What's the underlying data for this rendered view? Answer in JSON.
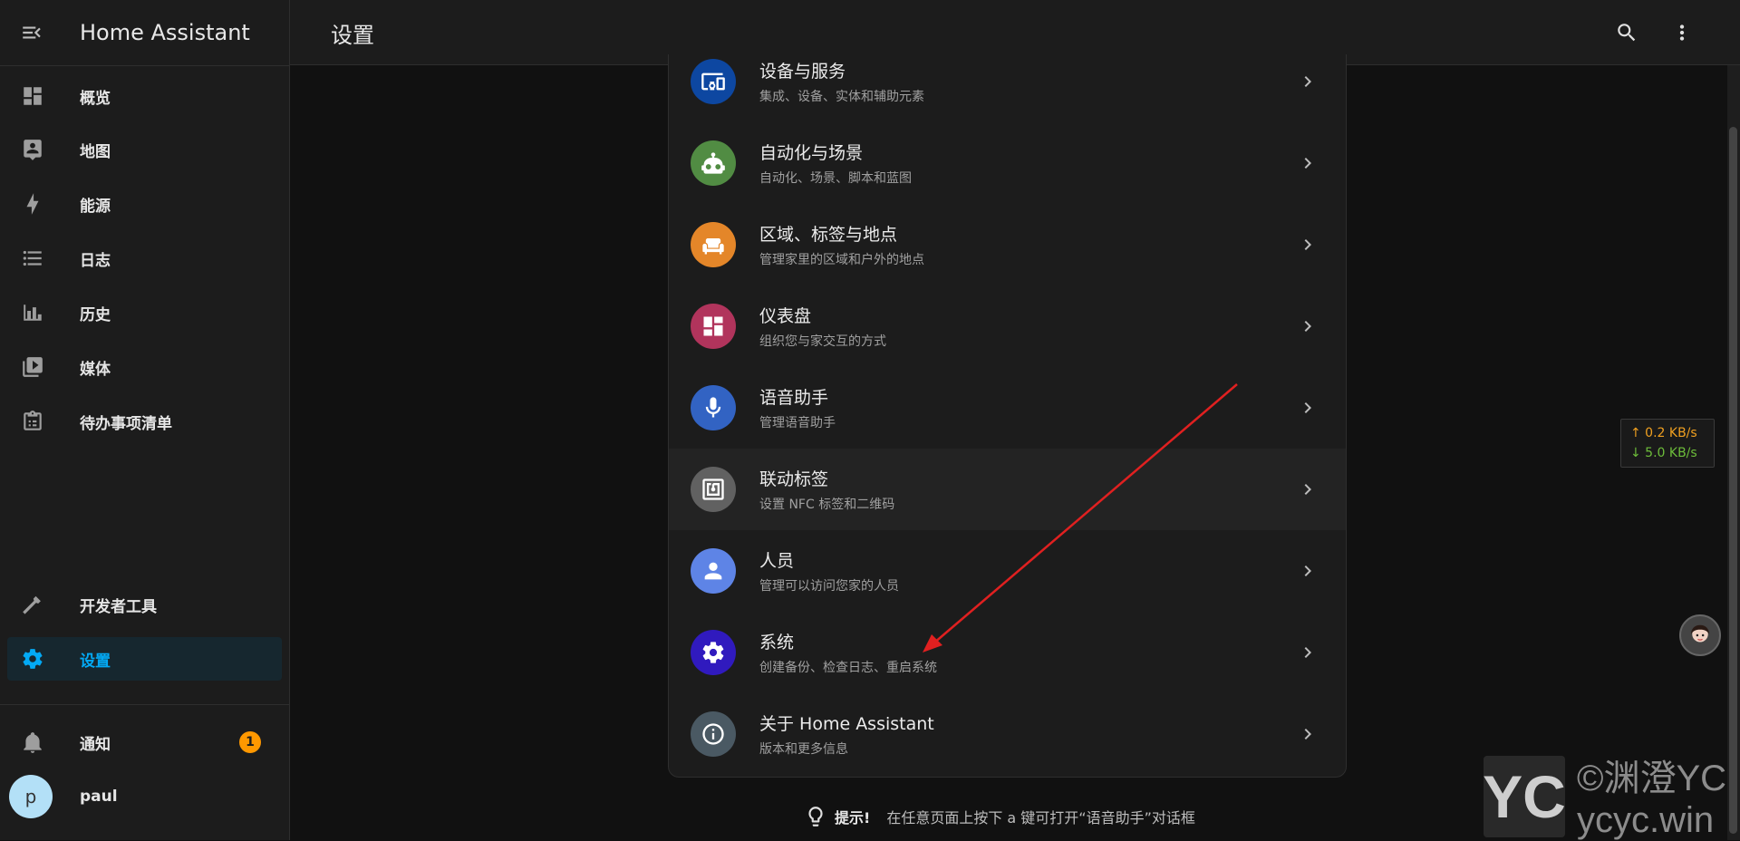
{
  "app": {
    "title": "Home Assistant"
  },
  "sidebar": {
    "items": [
      {
        "label": "概览",
        "icon": "dashboard-icon"
      },
      {
        "label": "地图",
        "icon": "map-icon"
      },
      {
        "label": "能源",
        "icon": "energy-icon"
      },
      {
        "label": "日志",
        "icon": "logbook-icon"
      },
      {
        "label": "历史",
        "icon": "history-icon"
      },
      {
        "label": "媒体",
        "icon": "media-icon"
      },
      {
        "label": "待办事项清单",
        "icon": "todo-icon"
      }
    ],
    "dev_tools": "开发者工具",
    "settings": "设置",
    "notifications": {
      "label": "通知",
      "count": "1"
    },
    "user": {
      "initial": "p",
      "name": "paul"
    }
  },
  "header": {
    "title": "设置"
  },
  "settings_list": [
    {
      "title": "设备与服务",
      "subtitle": "集成、设备、实体和辅助元素",
      "color": "#0d47a1",
      "icon": "devices-icon"
    },
    {
      "title": "自动化与场景",
      "subtitle": "自动化、场景、脚本和蓝图",
      "color": "#518c43",
      "icon": "robot-icon"
    },
    {
      "title": "区域、标签与地点",
      "subtitle": "管理家里的区域和户外的地点",
      "color": "#e48629",
      "icon": "sofa-icon"
    },
    {
      "title": "仪表盘",
      "subtitle": "组织您与家交互的方式",
      "color": "#b1345c",
      "icon": "dashboard-grid-icon"
    },
    {
      "title": "语音助手",
      "subtitle": "管理语音助手",
      "color": "#3263c3",
      "icon": "microphone-icon"
    },
    {
      "title": "联动标签",
      "subtitle": "设置 NFC 标签和二维码",
      "color": "#616161",
      "icon": "nfc-icon"
    },
    {
      "title": "人员",
      "subtitle": "管理可以访问您家的人员",
      "color": "#5e84e6",
      "icon": "account-icon"
    },
    {
      "title": "系统",
      "subtitle": "创建备份、检查日志、重启系统",
      "color": "#301abe",
      "icon": "cog-icon"
    },
    {
      "title": "关于 Home Assistant",
      "subtitle": "版本和更多信息",
      "color": "#4a5963",
      "icon": "info-icon"
    }
  ],
  "tip": {
    "label": "提示!",
    "text": "在任意页面上按下 a 键可打开“语音助手”对话框"
  },
  "net_speed": {
    "up": "↑ 0.2 KB/s",
    "down": "↓ 5.0 KB/s"
  },
  "watermark": {
    "logo": "YC",
    "line1": "©渊澄YC",
    "line2": "ycyc.win"
  },
  "colors": {
    "accent": "#03a9f4",
    "badge": "#ff9800",
    "annotation_arrow": "#e02020"
  }
}
